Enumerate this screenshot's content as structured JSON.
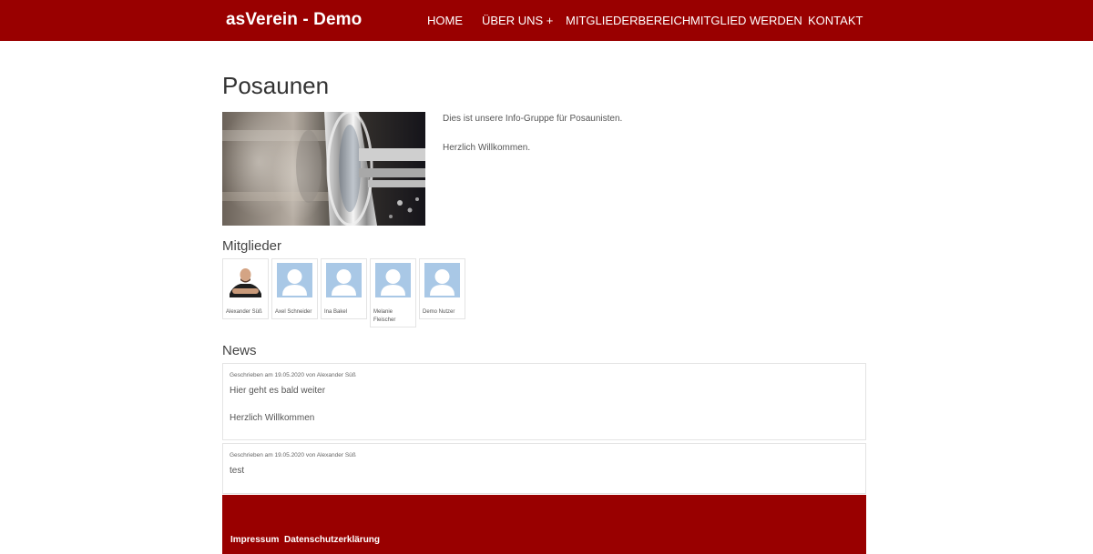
{
  "header": {
    "brand": "asVerein - Demo",
    "nav": [
      {
        "label": "HOME"
      },
      {
        "label": "ÜBER UNS +"
      },
      {
        "label": "MITGLIEDERBEREICH"
      },
      {
        "label": "MITGLIED WERDEN"
      },
      {
        "label": "KONTAKT"
      }
    ]
  },
  "page": {
    "title": "Posaunen",
    "intro": [
      "Dies ist unsere Info-Gruppe für Posaunisten.",
      "Herzlich Willkommen."
    ]
  },
  "members": {
    "title": "Mitglieder",
    "items": [
      {
        "name": "Alexander Süß"
      },
      {
        "name": "Axel Schneider"
      },
      {
        "name": "Ina Bakel"
      },
      {
        "name": "Melanie Fleischer"
      },
      {
        "name": "Demo Nutzer"
      }
    ]
  },
  "news": {
    "title": "News",
    "items": [
      {
        "meta": "Geschrieben am 19.05.2020 von Alexander Süß",
        "body": [
          "Hier geht es bald weiter",
          "Herzlich Willkommen"
        ]
      },
      {
        "meta": "Geschrieben am 19.05.2020 von Alexander Süß",
        "body": [
          "test"
        ]
      }
    ]
  },
  "footer": {
    "links": [
      {
        "label": "Impressum"
      },
      {
        "label": "Datenschutzerklärung"
      }
    ]
  },
  "colors": {
    "brand": "#990000",
    "avatar_placeholder": "#a9c8e6"
  }
}
